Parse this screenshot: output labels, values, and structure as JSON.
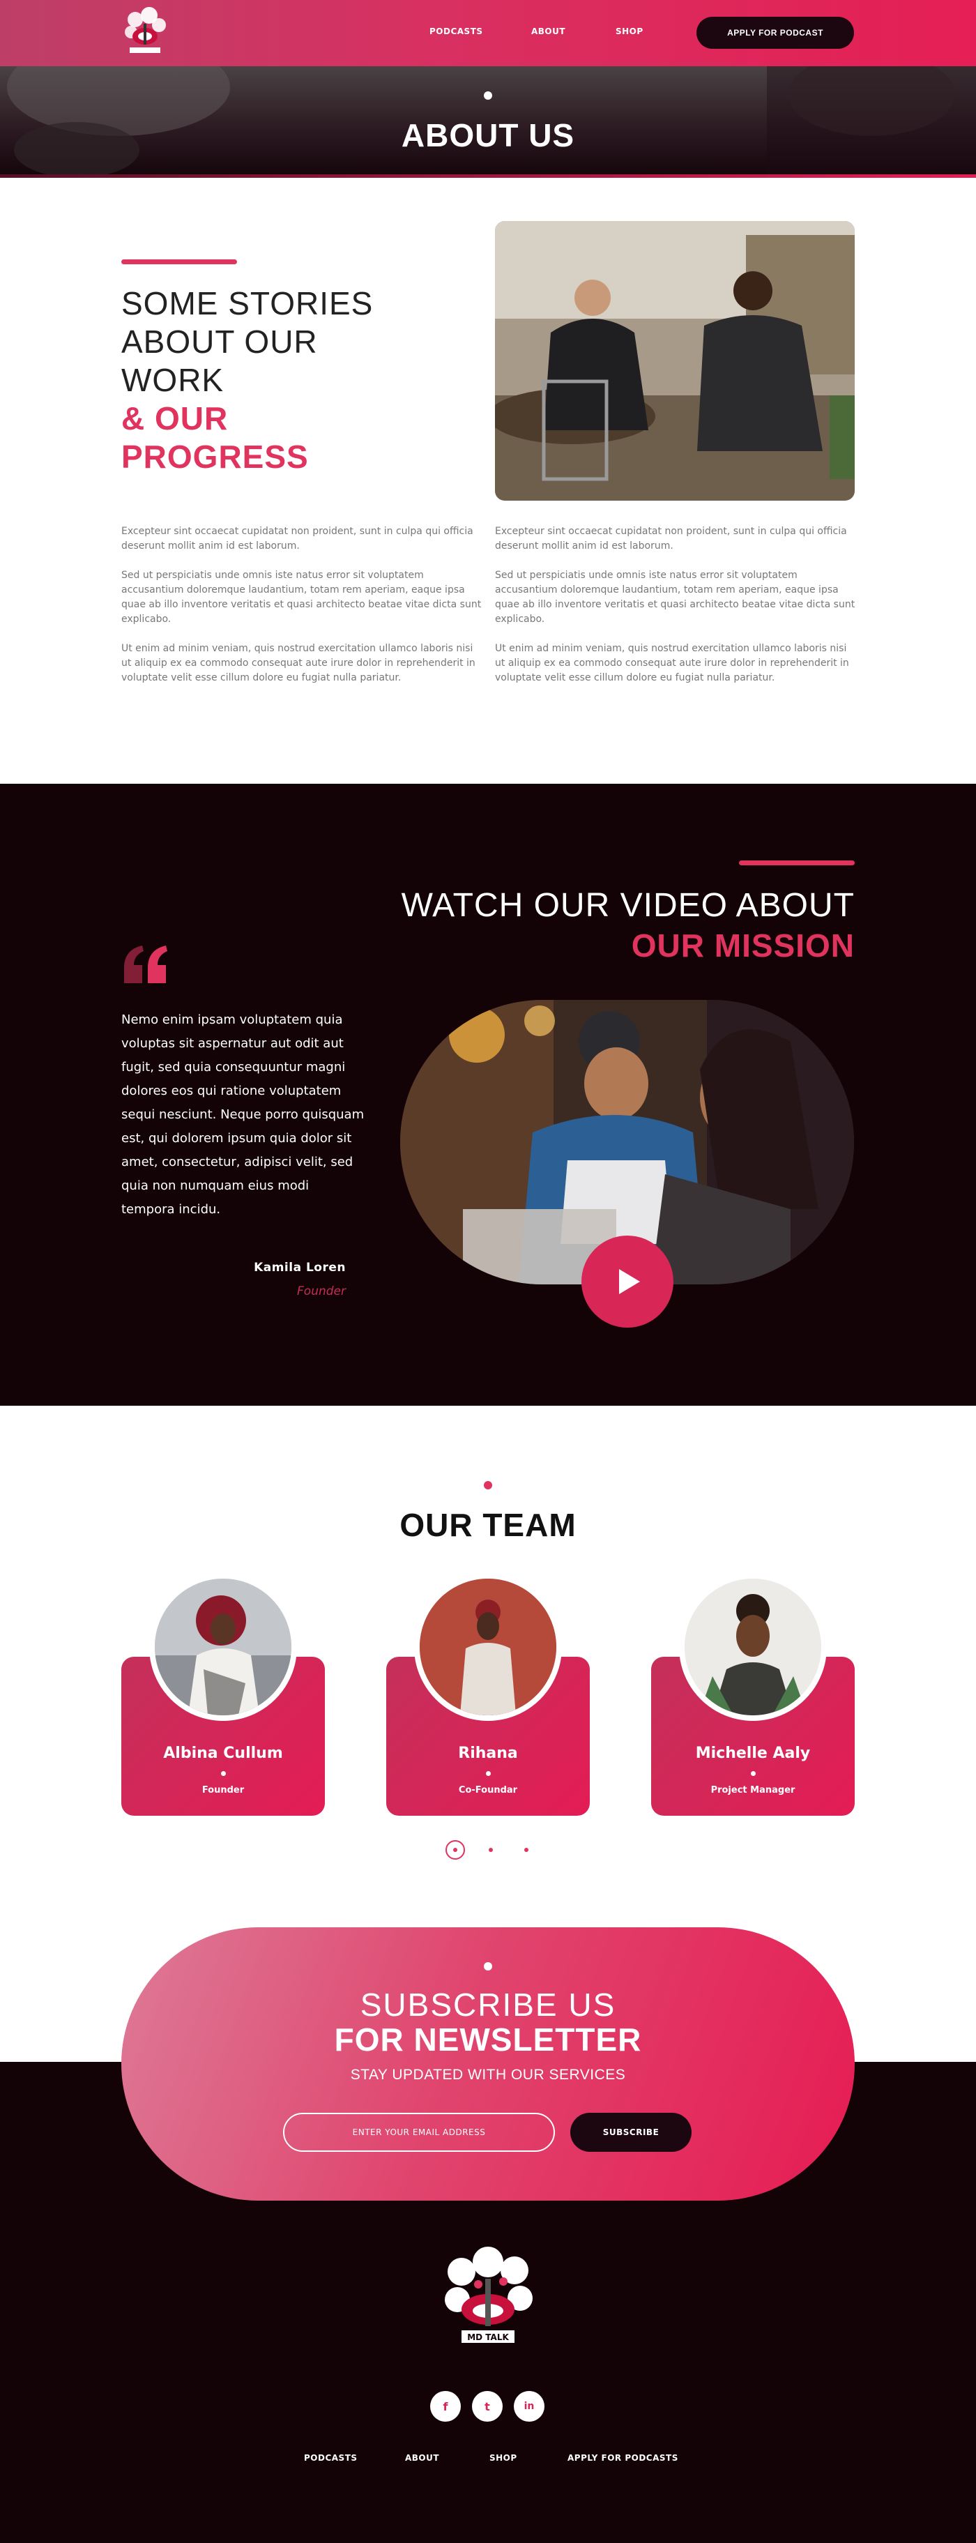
{
  "nav": {
    "podcasts": "PODCASTS",
    "about": "ABOUT",
    "shop": "SHOP",
    "cta": "APPLY FOR PODCAST"
  },
  "hero": {
    "title": "ABOUT US"
  },
  "about": {
    "heading_line1": "SOME STORIES",
    "heading_line2": "ABOUT OUR",
    "heading_line3": "WORK",
    "heading_bold1": "& OUR",
    "heading_bold2": "PROGRESS",
    "col1": [
      "Excepteur sint occaecat cupidatat non proident, sunt in culpa qui officia deserunt mollit anim id est laborum.",
      "Sed ut perspiciatis unde omnis iste natus error sit voluptatem accusantium doloremque laudantium, totam rem aperiam, eaque ipsa quae ab illo inventore veritatis et quasi architecto beatae vitae dicta sunt explicabo.",
      "Ut enim ad minim veniam, quis nostrud exercitation ullamco laboris nisi ut aliquip ex ea commodo consequat aute irure dolor in reprehenderit in voluptate velit esse cillum dolore eu fugiat nulla pariatur."
    ],
    "col2": [
      "Excepteur sint occaecat cupidatat non proident, sunt in culpa qui officia deserunt mollit anim id est laborum.",
      "Sed ut perspiciatis unde omnis iste natus error sit voluptatem accusantium doloremque laudantium, totam rem aperiam, eaque ipsa quae ab illo inventore veritatis et quasi architecto beatae vitae dicta sunt explicabo.",
      "Ut enim ad minim veniam, quis nostrud exercitation ullamco laboris nisi ut aliquip ex ea commodo consequat aute irure dolor in reprehenderit in voluptate velit esse cillum dolore eu fugiat nulla pariatur."
    ]
  },
  "mission": {
    "title_light": "WATCH OUR VIDEO ABOUT",
    "title_bold": "OUR MISSION",
    "quote": "Nemo enim ipsam voluptatem quia voluptas sit aspernatur aut odit aut fugit, sed quia consequuntur magni dolores eos qui ratione voluptatem sequi nesciunt. Neque porro quisquam est, qui dolorem ipsum quia dolor sit amet, consectetur, adipisci velit, sed quia non numquam eius modi tempora incidu.",
    "author": "Kamila Loren",
    "role": "Founder"
  },
  "team": {
    "title": "OUR TEAM",
    "members": [
      {
        "name": "Albina Cullum",
        "role": "Founder"
      },
      {
        "name": "Rihana",
        "role": "Co-Foundar"
      },
      {
        "name": "Michelle Aaly",
        "role": "Project Manager"
      }
    ]
  },
  "newsletter": {
    "title_light": "SUBSCRIBE US",
    "title_bold": "FOR NEWSLETTER",
    "subtitle": "STAY UPDATED WITH OUR SERVICES",
    "placeholder": "ENTER YOUR EMAIL ADDRESS",
    "button": "SUBSCRIBE"
  },
  "footer": {
    "logo_text": "MD TALK",
    "social": [
      "f",
      "t",
      "in"
    ],
    "links": {
      "podcasts": "PODCASTS",
      "about": "ABOUT",
      "shop": "SHOP",
      "apply": "APPLY FOR PODCASTS"
    }
  },
  "colors": {
    "accent": "#e0345f",
    "brand_pink": "#e51f55",
    "dark": "#130307",
    "cta_dark": "#1c0710"
  },
  "icons": [
    "logo-icon",
    "quote-icon",
    "play-icon",
    "facebook-icon",
    "twitter-icon",
    "linkedin-icon"
  ]
}
